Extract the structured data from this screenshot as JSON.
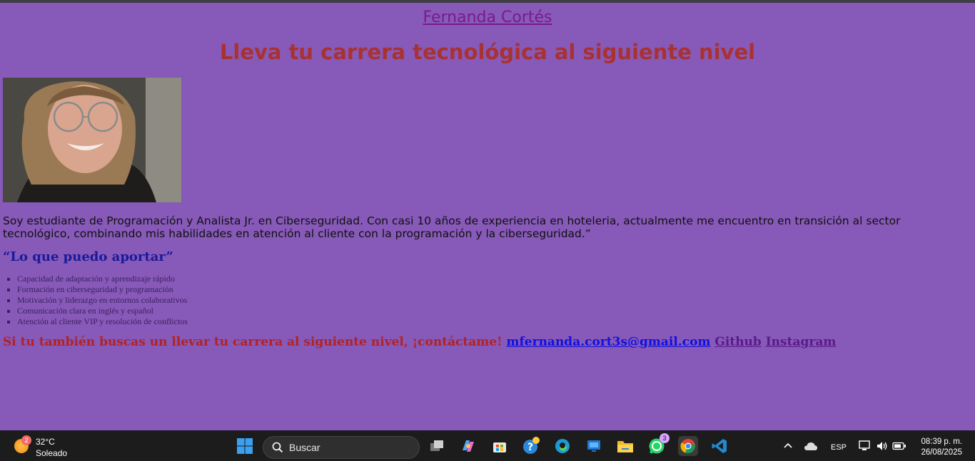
{
  "header": {
    "name_link": "Fernanda Cortés",
    "headline": "Lleva tu carrera tecnológica al siguiente nivel"
  },
  "bio": "Soy estudiante de Programación y Analista Jr. en Ciberseguridad. Con casi 10 años de experiencia en hoteleria, actualmente me encuentro en transición al sector tecnológico, combinando mis habilidades en atención al cliente con la programación y la ciberseguridad.”",
  "skills_section": {
    "title": "“Lo que puedo aportar”",
    "items": [
      "Capacidad de adaptación y aprendizaje rápido",
      "Formación en ciberseguridad y programación",
      "Motivación y liderazgo en entornos colaborativos",
      "Comunicación clara en inglés y español",
      "Atención al cliente VIP y resolución de conflictos"
    ]
  },
  "contact": {
    "cta": "Si tu también buscas un llevar tu carrera al siguiente nivel, ¡contáctame!",
    "email": "mfernanda.cort3s@gmail.com",
    "github": "Github",
    "instagram": "Instagram"
  },
  "taskbar": {
    "weather": {
      "temp": "32°C",
      "condition": "Soleado",
      "badge": "2"
    },
    "search_placeholder": "Buscar",
    "whatsapp_badge": "3",
    "language": "ESP",
    "time": "08:39 p. m.",
    "date": "26/08/2025"
  },
  "colors": {
    "page_background": "#8759b8",
    "headline": "#a83232",
    "section_title": "#1a1a9a",
    "taskbar": "#1c1c1c"
  }
}
